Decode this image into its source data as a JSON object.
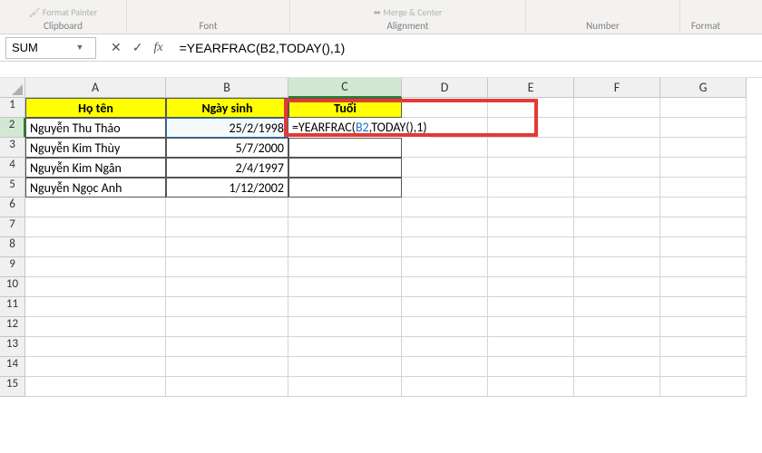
{
  "ribbon": {
    "format_painter": "Format Painter",
    "merge_center": "Merge & Center",
    "format": "Format",
    "groups": {
      "clipboard": "Clipboard",
      "font": "Font",
      "alignment": "Alignment",
      "number": "Number"
    }
  },
  "namebox": {
    "value": "SUM"
  },
  "formula_bar": {
    "cancel": "✕",
    "enter": "✓",
    "fx": "fx",
    "formula": "=YEARFRAC(B2,TODAY(),1)"
  },
  "columns": [
    "A",
    "B",
    "C",
    "D",
    "E",
    "F",
    "G"
  ],
  "rows": [
    "1",
    "2",
    "3",
    "4",
    "5",
    "6",
    "7",
    "8",
    "9",
    "10",
    "11",
    "12",
    "13",
    "14",
    "15"
  ],
  "active_col_index": 2,
  "active_row_index": 1,
  "headers": {
    "a": "Họ tên",
    "b": "Ngày sinh",
    "c": "Tuổi"
  },
  "table": [
    {
      "name": "Nguyễn Thu Thảo",
      "dob": "25/2/1998"
    },
    {
      "name": "Nguyễn Kim Thùy",
      "dob": "5/7/2000"
    },
    {
      "name": "Nguyễn Kim Ngân",
      "dob": "2/4/1997"
    },
    {
      "name": "Nguyễn Ngọc Anh",
      "dob": "1/12/2002"
    }
  ],
  "cell_edit": {
    "prefix": "=YEARFRAC(",
    "ref": "B2",
    "mid": ",TODAY(),1)"
  }
}
